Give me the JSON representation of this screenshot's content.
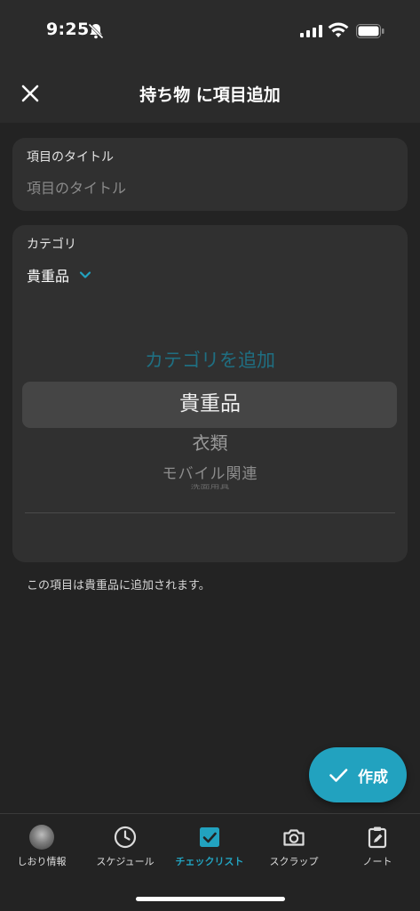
{
  "status_bar": {
    "time": "9:25"
  },
  "header": {
    "title": "持ち物 に項目追加"
  },
  "title_field": {
    "label": "項目のタイトル",
    "placeholder": "項目のタイトル",
    "value": ""
  },
  "category_field": {
    "label": "カテゴリ",
    "selected": "貴重品",
    "picker": {
      "add_label": "カテゴリを追加",
      "selected": "貴重品",
      "options": [
        "衣類",
        "モバイル関連",
        "洗面用具"
      ]
    }
  },
  "hint": "この項目は貴重品に追加されます。",
  "create_button": {
    "label": "作成"
  },
  "tabs": [
    {
      "label": "しおり情報",
      "icon": "avatar-icon",
      "active": false
    },
    {
      "label": "スケジュール",
      "icon": "clock-icon",
      "active": false
    },
    {
      "label": "チェックリスト",
      "icon": "checkbox-icon",
      "active": true
    },
    {
      "label": "スクラップ",
      "icon": "camera-icon",
      "active": false
    },
    {
      "label": "ノート",
      "icon": "note-icon",
      "active": false
    }
  ],
  "colors": {
    "accent": "#22a2bf",
    "background": "#232323",
    "card": "#303030"
  }
}
